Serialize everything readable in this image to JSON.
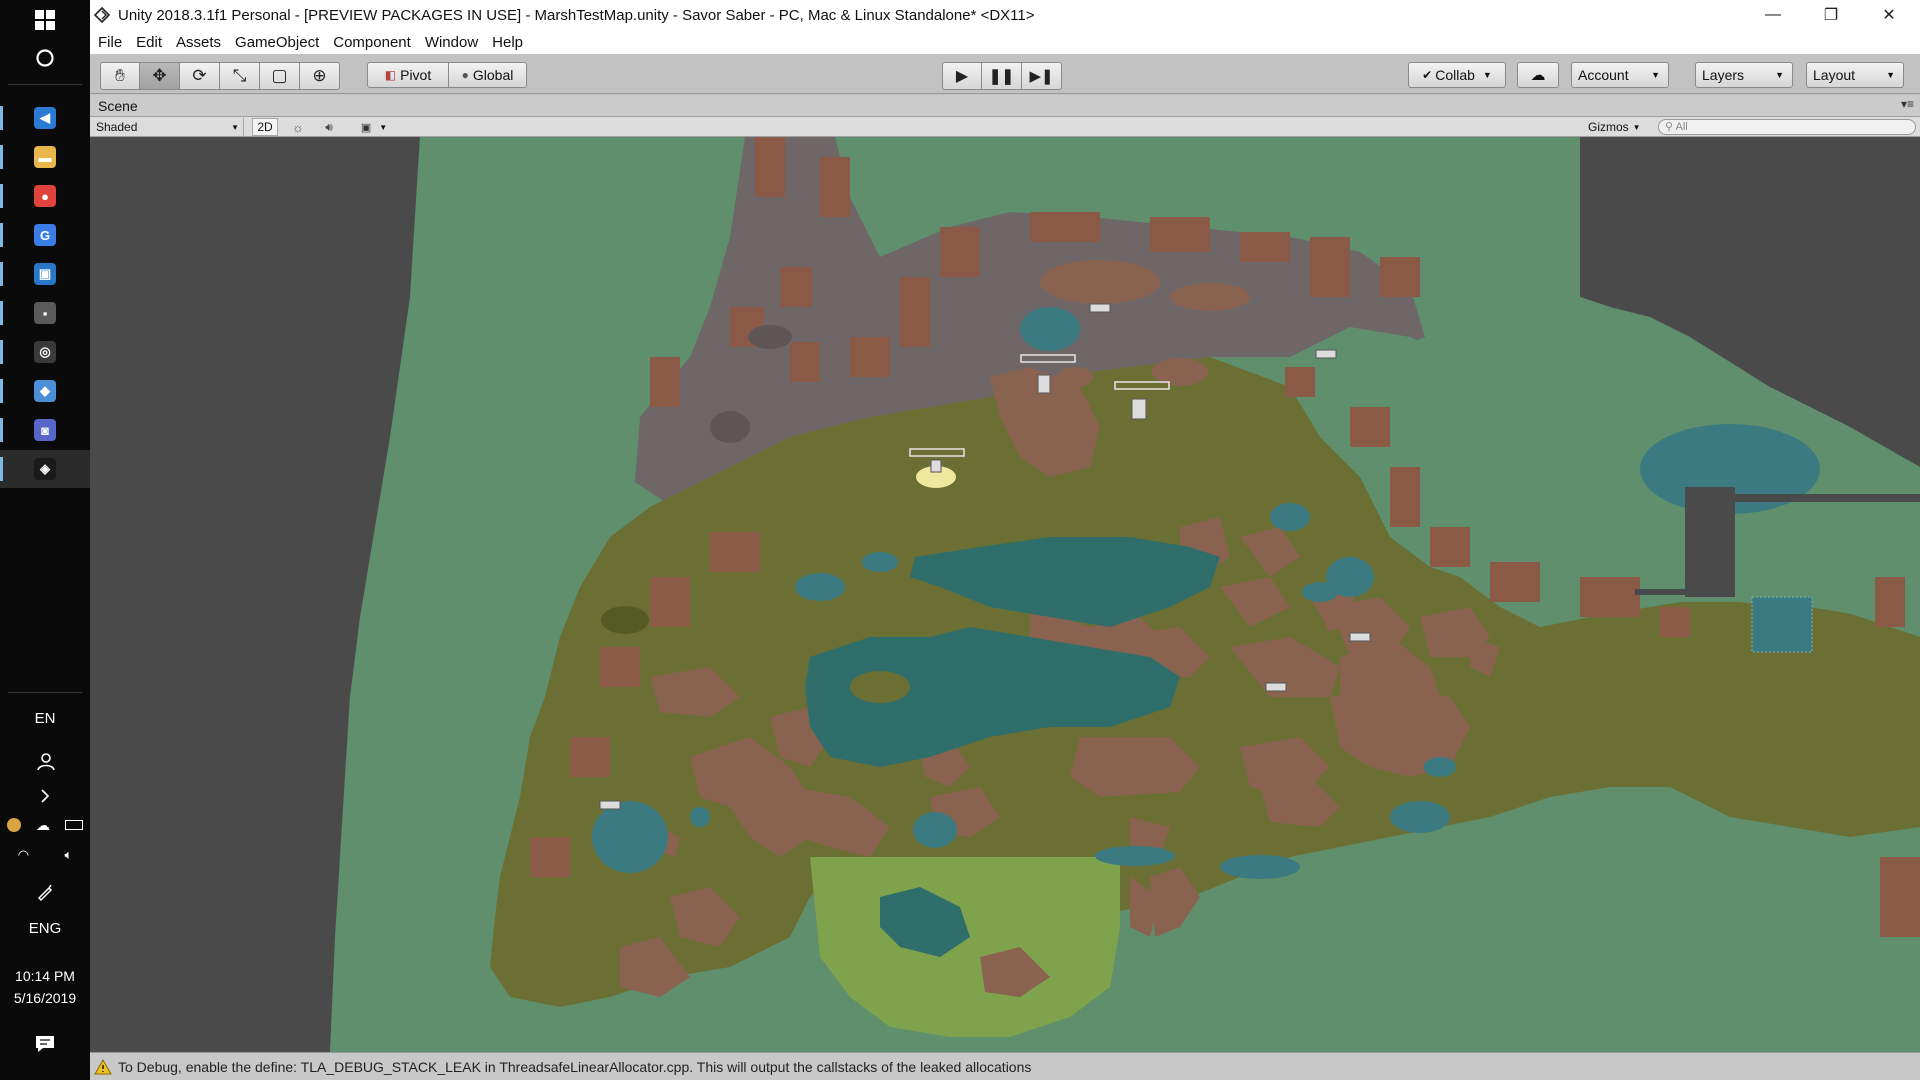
{
  "taskbar": {
    "apps": [
      {
        "name": "vscode",
        "icon": "vscode-icon",
        "color": "#2b7bd4",
        "glyph": "◀"
      },
      {
        "name": "file-explorer",
        "icon": "folder-icon",
        "color": "#e8b64a",
        "glyph": "▬"
      },
      {
        "name": "chrome",
        "icon": "chrome-icon",
        "color": "#e0433a",
        "glyph": "●"
      },
      {
        "name": "google",
        "icon": "google-icon",
        "color": "#3b7de8",
        "glyph": "G"
      },
      {
        "name": "calendar",
        "icon": "window-app-icon",
        "color": "#2a77c9",
        "glyph": "▣"
      },
      {
        "name": "chat",
        "icon": "chat-app-icon",
        "color": "#5a5a5a",
        "glyph": "▪"
      },
      {
        "name": "gitkraken",
        "icon": "gitkraken-icon",
        "color": "#3a3a3a",
        "glyph": "◎"
      },
      {
        "name": "notes",
        "icon": "notes-icon",
        "color": "#4a8fd8",
        "glyph": "◆"
      },
      {
        "name": "discord",
        "icon": "discord-icon",
        "color": "#5865c9",
        "glyph": "◙"
      },
      {
        "name": "unity",
        "icon": "unity-icon",
        "color": "#1a1a1a",
        "glyph": "◈"
      }
    ],
    "lang": "EN",
    "keyboard": "ENG",
    "time": "10:14 PM",
    "date": "5/16/2019"
  },
  "window": {
    "title": "Unity 2018.3.1f1 Personal - [PREVIEW PACKAGES IN USE] - MarshTestMap.unity - Savor Saber - PC, Mac & Linux Standalone* <DX11>",
    "minimize": "—",
    "maximize": "❐",
    "close": "✕"
  },
  "menu": [
    "File",
    "Edit",
    "Assets",
    "GameObject",
    "Component",
    "Window",
    "Help"
  ],
  "toolbar": {
    "pivot_label": "Pivot",
    "global_label": "Global",
    "collab_label": "Collab",
    "account_label": "Account",
    "layers_label": "Layers",
    "layout_label": "Layout"
  },
  "scene": {
    "tab_label": "Scene",
    "shading": "Shaded",
    "mode_2d": "2D",
    "gizmos": "Gizmos",
    "search_placeholder": "All"
  },
  "console": {
    "message": "To Debug, enable the define: TLA_DEBUG_STACK_LEAK in ThreadsafeLinearAllocator.cpp. This will output the callstacks of the leaked allocations"
  }
}
